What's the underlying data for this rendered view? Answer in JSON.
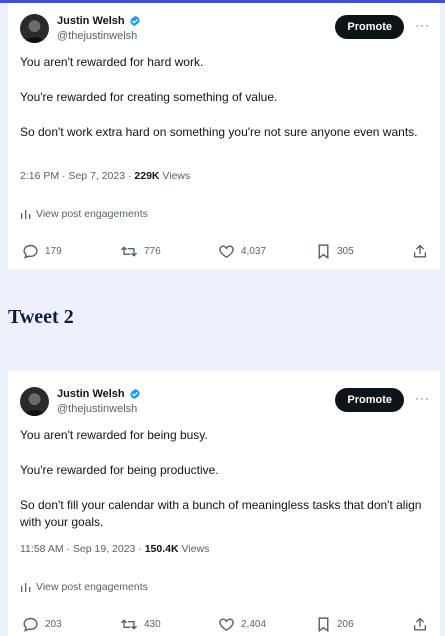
{
  "tweets": [
    {
      "author": {
        "name": "Justin Welsh",
        "handle": "@thejustinwelsh"
      },
      "promote_label": "Promote",
      "more_label": "···",
      "lines": [
        "You aren't rewarded for hard work.",
        "You're rewarded for creating something of value.",
        "So don't work extra hard on something you're not sure anyone even wants."
      ],
      "meta": {
        "time_date": "2:16 PM · Sep 7, 2023 · ",
        "views_count": "229K",
        "views_label": " Views"
      },
      "engagements_label": "View post engagements",
      "stats": {
        "replies": "179",
        "reposts": "776",
        "likes": "4,037",
        "bookmarks": "305"
      }
    },
    {
      "author": {
        "name": "Justin Welsh",
        "handle": "@thejustinwelsh"
      },
      "promote_label": "Promote",
      "more_label": "···",
      "lines": [
        "You aren't rewarded for being busy.",
        "You're rewarded for being productive.",
        "So don't fill your calendar with a bunch of meaningless tasks that don't align with your goals."
      ],
      "meta": {
        "time_date": "11:58 AM · Sep 19, 2023 · ",
        "views_count": "150.4K",
        "views_label": " Views"
      },
      "engagements_label": "View post engagements",
      "stats": {
        "replies": "203",
        "reposts": "430",
        "likes": "2,404",
        "bookmarks": "206"
      }
    }
  ],
  "section_title": "Tweet 2",
  "colors": {
    "verified": "#1d9bf0",
    "accent_bar": "#3d4fe0",
    "background": "#eef0fb"
  },
  "icons": [
    "verified-badge-icon",
    "analytics-icon",
    "reply-icon",
    "repost-icon",
    "like-icon",
    "bookmark-icon",
    "share-icon"
  ]
}
